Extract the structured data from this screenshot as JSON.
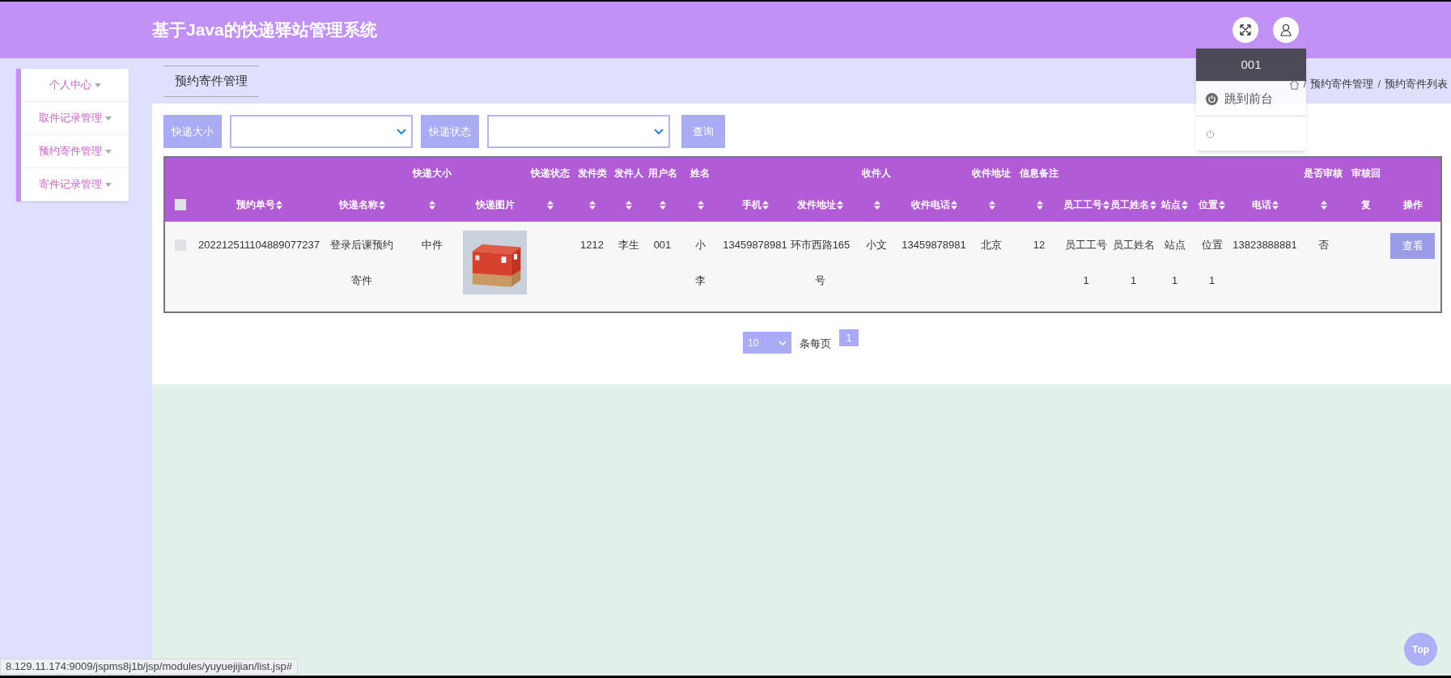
{
  "header": {
    "title": "基于Java的快递驿站管理系统"
  },
  "user_menu": {
    "username": "001",
    "items": [
      {
        "kind": "frontend",
        "label": "跳到前台"
      },
      {
        "kind": "logout"
      }
    ]
  },
  "sidebar": {
    "items": [
      {
        "label": "个人中心"
      },
      {
        "label": "取件记录管理"
      },
      {
        "label": "预约寄件管理"
      },
      {
        "label": "寄件记录管理"
      }
    ]
  },
  "tab": {
    "label": "预约寄件管理"
  },
  "breadcrumb": {
    "separator": "/",
    "items": [
      "预约寄件管理",
      "预约寄件列表"
    ]
  },
  "filters": [
    {
      "label": "快递大小"
    },
    {
      "label": "快递状态"
    }
  ],
  "search_button": "查询",
  "table": {
    "header_checked": false,
    "columns": [
      {
        "kind": "checkbox"
      },
      {
        "kind": "text",
        "label": "预约单号",
        "sortable": true
      },
      {
        "kind": "text",
        "label": "快递名称",
        "sortable": true
      },
      {
        "kind": "text",
        "top": "快递大小",
        "sortable": true
      },
      {
        "label": "快递图片",
        "sortable": false
      },
      {
        "kind": "text",
        "top": "快递状态",
        "sortable": true
      },
      {
        "kind": "text",
        "top": "发件类",
        "sortable": true
      },
      {
        "kind": "text",
        "top": "发件人",
        "sortable": true
      },
      {
        "kind": "text",
        "top": "用户名",
        "sortable": true
      },
      {
        "kind": "text",
        "top": "姓名",
        "sortable": true
      },
      {
        "kind": "text",
        "label": "手机",
        "sortable": true
      },
      {
        "kind": "text",
        "label": "发件地址",
        "sortable": true
      },
      {
        "kind": "text",
        "top": "收件人",
        "sortable": true
      },
      {
        "kind": "text",
        "label": "收件电话",
        "sortable": true
      },
      {
        "kind": "text",
        "top": "收件地址",
        "sortable": true
      },
      {
        "kind": "text",
        "top": "信息备注",
        "sortable": true
      },
      {
        "kind": "text",
        "label": "员工工号",
        "sortable": true
      },
      {
        "kind": "text",
        "label": "员工姓名",
        "sortable": true
      },
      {
        "kind": "text",
        "label": "站点",
        "sortable": true
      },
      {
        "kind": "text",
        "label": "位置",
        "sortable": true
      },
      {
        "kind": "text",
        "label": "电话",
        "sortable": true
      },
      {
        "kind": "text",
        "top": "是否审核",
        "sortable": true
      },
      {
        "kind": "text",
        "top": "审核回",
        "label": "复",
        "sortable": false
      },
      {
        "kind": "action",
        "label": "操作",
        "sortable": false
      }
    ],
    "rows": [
      {
        "checked": false,
        "cells": [
          "",
          "202212511104889077237",
          "登录后课预约寄件",
          "中件",
          "",
          "",
          "1212",
          "李生",
          "001",
          "小李",
          "13459878981",
          "环市西路165号",
          "小文",
          "13459878981",
          "北京",
          "12",
          "员工工号1",
          "员工姓名1",
          "站点1",
          "位置1",
          "13823888881",
          "否",
          "",
          "查看"
        ]
      }
    ]
  },
  "pagination": {
    "page_size": "10",
    "page_size_label": "条每页",
    "pages": [
      {
        "label": "1",
        "selected": true
      }
    ]
  },
  "status_bar": {
    "url": "8.129.11.174:9009/jspms8j1b/jsp/modules/yuyuejijian/list.jsp#"
  },
  "top_button": "Top"
}
